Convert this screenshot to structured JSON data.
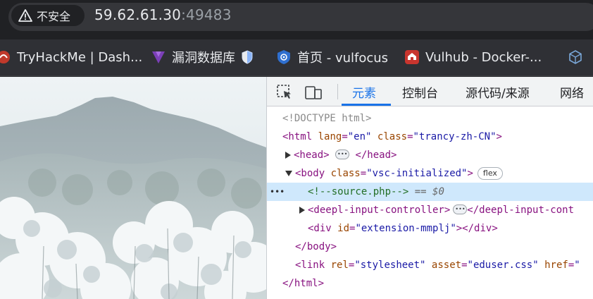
{
  "address_bar": {
    "security_label": "不安全",
    "url_host": "59.62.61.30",
    "url_port": ":49483"
  },
  "bookmarks": [
    {
      "label": "TryHackMe | Dash...",
      "icon": "tryhackme-icon"
    },
    {
      "label": "漏洞数据库",
      "icon": "vuln-db-icon"
    },
    {
      "label": "首页 - vulfocus",
      "icon": "vulfocus-icon"
    },
    {
      "label": "Vulhub - Docker-...",
      "icon": "vulhub-icon"
    },
    {
      "label": "",
      "icon": "cube-icon"
    }
  ],
  "devtools": {
    "tabs": [
      "元素",
      "控制台",
      "源代码/来源",
      "网络"
    ],
    "active_tab": "元素",
    "dom_lines": {
      "doctype": "<!DOCTYPE html>",
      "html_open": {
        "tag": "<html",
        "a1": "lang",
        "v1": "\"en\"",
        "a2": "class",
        "v2": "\"trancy-zh-CN\"",
        "end": ">"
      },
      "head": {
        "open": "<head>",
        "close": "</head>"
      },
      "body_open": {
        "tag": "<body",
        "a1": "class",
        "v1": "\"vsc-initialized\"",
        "end": ">",
        "badge": "flex"
      },
      "comment": {
        "text": "<!--source.php-->",
        "eq": "== $0"
      },
      "deepl": {
        "open": "<deepl-input-controller>",
        "close": "</deepl-input-cont"
      },
      "div": {
        "tag": "<div",
        "a1": "id",
        "v1": "\"extension-mmplj\"",
        "end": "></div>"
      },
      "body_close": "</body>",
      "link": {
        "tag": "<link",
        "a1": "rel",
        "v1": "\"stylesheet\"",
        "a2": "asset",
        "v2": "\"eduser.css\"",
        "a3": "href",
        "v3": "\""
      },
      "html_close": "</html>"
    }
  },
  "colors": {
    "active_tab": "#1a73e8",
    "tag": "#881280",
    "attr": "#994500",
    "value": "#1a1aa6",
    "comment": "#236e25",
    "selected_row": "#cfe8fc"
  }
}
